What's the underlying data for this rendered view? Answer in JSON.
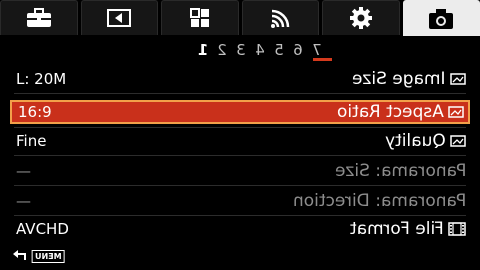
{
  "tabs": [
    {
      "icon": "toolbox-icon"
    },
    {
      "icon": "playback-icon"
    },
    {
      "icon": "grid-icon"
    },
    {
      "icon": "wireless-icon"
    },
    {
      "icon": "gear-icon"
    },
    {
      "icon": "camera-icon",
      "active": true
    }
  ],
  "pages": [
    "1",
    "2",
    "3",
    "4",
    "5",
    "6",
    "7"
  ],
  "active_page": "1",
  "menu": [
    {
      "label": "Image Size",
      "value": "L: 20M",
      "icon": "image-size-icon"
    },
    {
      "label": "Aspect Ratio",
      "value": "16:9",
      "icon": "aspect-ratio-icon",
      "selected": true
    },
    {
      "label": "Quality",
      "value": "Fine",
      "icon": "quality-icon"
    },
    {
      "label": "Panorama: Size",
      "value": "—",
      "dim": true
    },
    {
      "label": "Panorama: Direction",
      "value": "—",
      "dim": true
    },
    {
      "label": "File Format",
      "value": "AVCHD",
      "icon": "film-icon"
    }
  ],
  "footer": {
    "back_icon": "return-arrow-icon",
    "menu_label": "MENU"
  },
  "colors": {
    "accent": "#c9301b",
    "selection_border": "#f2a04a",
    "underline": "#d53a1d"
  }
}
